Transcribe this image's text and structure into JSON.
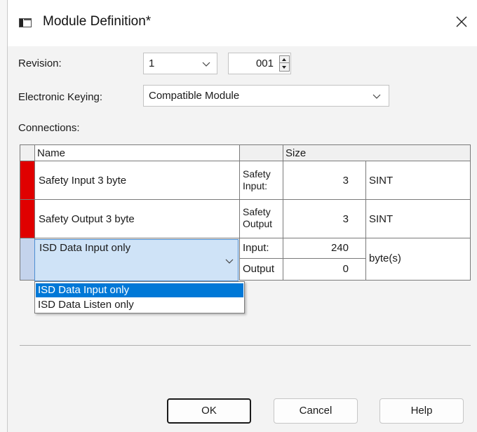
{
  "window": {
    "title": "Module Definition*"
  },
  "revision": {
    "label": "Revision:",
    "major": "1",
    "minor": "001"
  },
  "electronic_keying": {
    "label": "Electronic Keying:",
    "value": "Compatible Module"
  },
  "connections": {
    "label": "Connections:",
    "headers": {
      "name": "Name",
      "size": "Size"
    },
    "rows": [
      {
        "name": "Safety Input 3 byte",
        "type": "Safety\nInput:",
        "size": "3",
        "unit": "SINT",
        "color": "#e00000"
      },
      {
        "name": "Safety Output 3 byte",
        "type": "Safety\nOutput",
        "size": "3",
        "unit": "SINT",
        "color": "#e00000"
      },
      {
        "name": "ISD Data Input only",
        "type_in": "Input:",
        "size_in": "240",
        "type_out": "Output",
        "size_out": "0",
        "unit": "byte(s)",
        "color": "#c4d3ec"
      }
    ],
    "dropdown_options": [
      "ISD Data Input only",
      "ISD Data Listen only"
    ]
  },
  "buttons": {
    "ok": "OK",
    "cancel": "Cancel",
    "help": "Help"
  },
  "icons": [
    "window-icon",
    "close-icon",
    "chevron-down-icon",
    "spin-up-icon",
    "spin-down-icon"
  ]
}
